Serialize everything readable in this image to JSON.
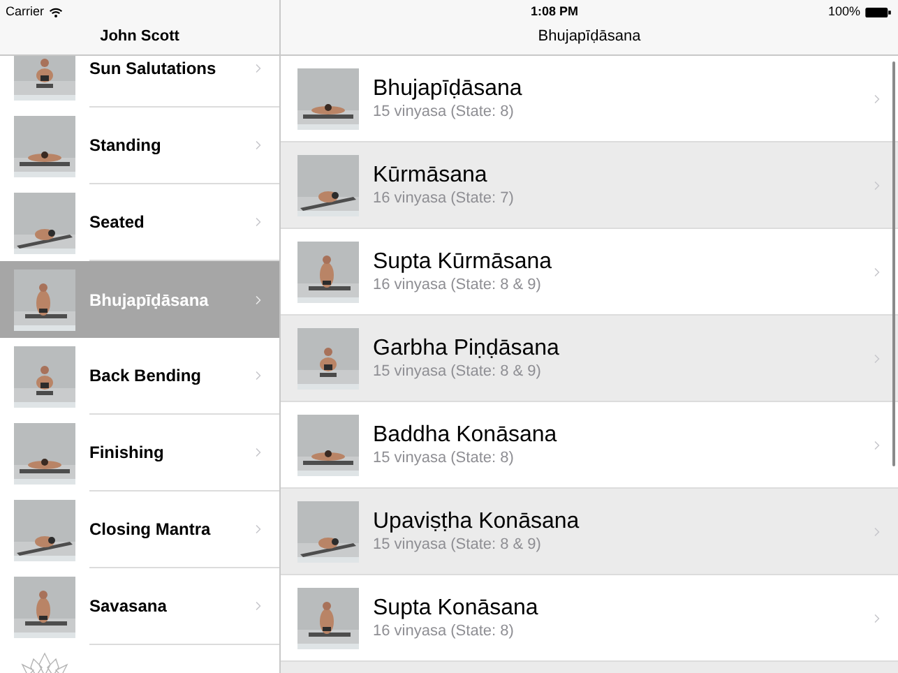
{
  "status_bar": {
    "carrier": "Carrier",
    "time": "1:08 PM",
    "battery": "100%"
  },
  "sidebar": {
    "title": "John Scott",
    "items": [
      {
        "label": "Sun Salutations",
        "selected": false
      },
      {
        "label": "Standing",
        "selected": false
      },
      {
        "label": "Seated",
        "selected": false
      },
      {
        "label": "Bhujapīḍāsana",
        "selected": true
      },
      {
        "label": "Back Bending",
        "selected": false
      },
      {
        "label": "Finishing",
        "selected": false
      },
      {
        "label": "Closing Mantra",
        "selected": false
      },
      {
        "label": "Savasana",
        "selected": false
      }
    ]
  },
  "detail": {
    "title": "Bhujapīḍāsana",
    "rows": [
      {
        "title": "Bhujapīḍāsana",
        "subtitle": "15 vinyasa (State: 8)"
      },
      {
        "title": "Kūrmāsana",
        "subtitle": "16 vinyasa (State: 7)"
      },
      {
        "title": "Supta Kūrmāsana",
        "subtitle": "16 vinyasa (State: 8 & 9)"
      },
      {
        "title": "Garbha Piṇḍāsana",
        "subtitle": "15 vinyasa (State: 8 & 9)"
      },
      {
        "title": "Baddha Konāsana",
        "subtitle": "15 vinyasa (State: 8)"
      },
      {
        "title": "Upaviṣṭha Konāsana",
        "subtitle": "15 vinyasa (State: 8 & 9)"
      },
      {
        "title": "Supta Konāsana",
        "subtitle": "16 vinyasa (State: 8)"
      }
    ]
  }
}
